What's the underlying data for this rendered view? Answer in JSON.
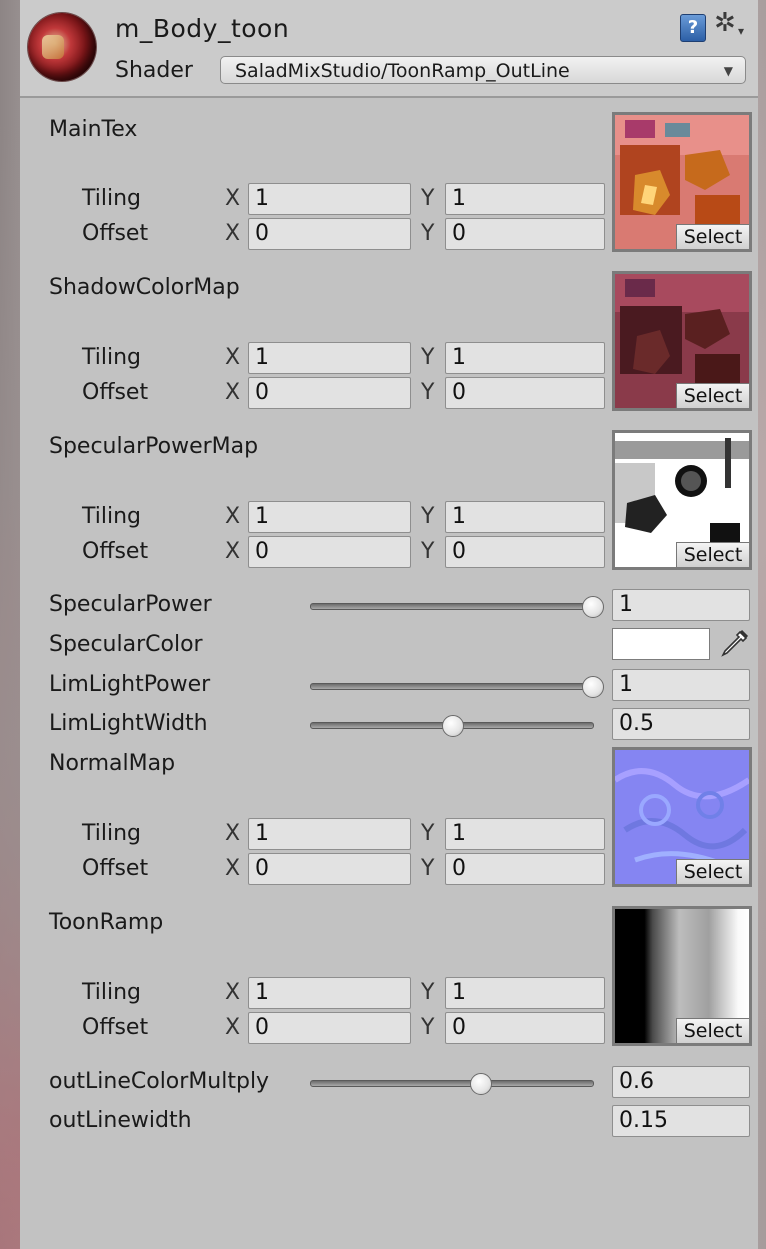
{
  "header": {
    "material_name": "m_Body_toon",
    "shader_label": "Shader",
    "shader_value": "SaladMixStudio/ToonRamp_OutLine",
    "help_icon": "?"
  },
  "textures": [
    {
      "name": "MainTex",
      "tiling_label": "Tiling",
      "offset_label": "Offset",
      "tiling_x": "1",
      "tiling_y": "1",
      "offset_x": "0",
      "offset_y": "0",
      "select": "Select"
    },
    {
      "name": "ShadowColorMap",
      "tiling_label": "Tiling",
      "offset_label": "Offset",
      "tiling_x": "1",
      "tiling_y": "1",
      "offset_x": "0",
      "offset_y": "0",
      "select": "Select"
    },
    {
      "name": "SpecularPowerMap",
      "tiling_label": "Tiling",
      "offset_label": "Offset",
      "tiling_x": "1",
      "tiling_y": "1",
      "offset_x": "0",
      "offset_y": "0",
      "select": "Select"
    },
    {
      "name": "NormalMap",
      "tiling_label": "Tiling",
      "offset_label": "Offset",
      "tiling_x": "1",
      "tiling_y": "1",
      "offset_x": "0",
      "offset_y": "0",
      "select": "Select"
    },
    {
      "name": "ToonRamp",
      "tiling_label": "Tiling",
      "offset_label": "Offset",
      "tiling_x": "1",
      "tiling_y": "1",
      "offset_x": "0",
      "offset_y": "0",
      "select": "Select"
    }
  ],
  "axis_labels": {
    "x": "X",
    "y": "Y"
  },
  "sliders": [
    {
      "name": "SpecularPower",
      "value": "1",
      "fraction": 1.0
    },
    {
      "name": "LimLightPower",
      "value": "1",
      "fraction": 1.0
    },
    {
      "name": "LimLightWidth",
      "value": "0.5",
      "fraction": 0.5
    },
    {
      "name": "outLineColorMultply",
      "value": "0.6",
      "fraction": 0.6
    }
  ],
  "specular_color": {
    "name": "SpecularColor",
    "color": "#ffffff"
  },
  "outline_width": {
    "name": "outLinewidth",
    "value": "0.15"
  }
}
